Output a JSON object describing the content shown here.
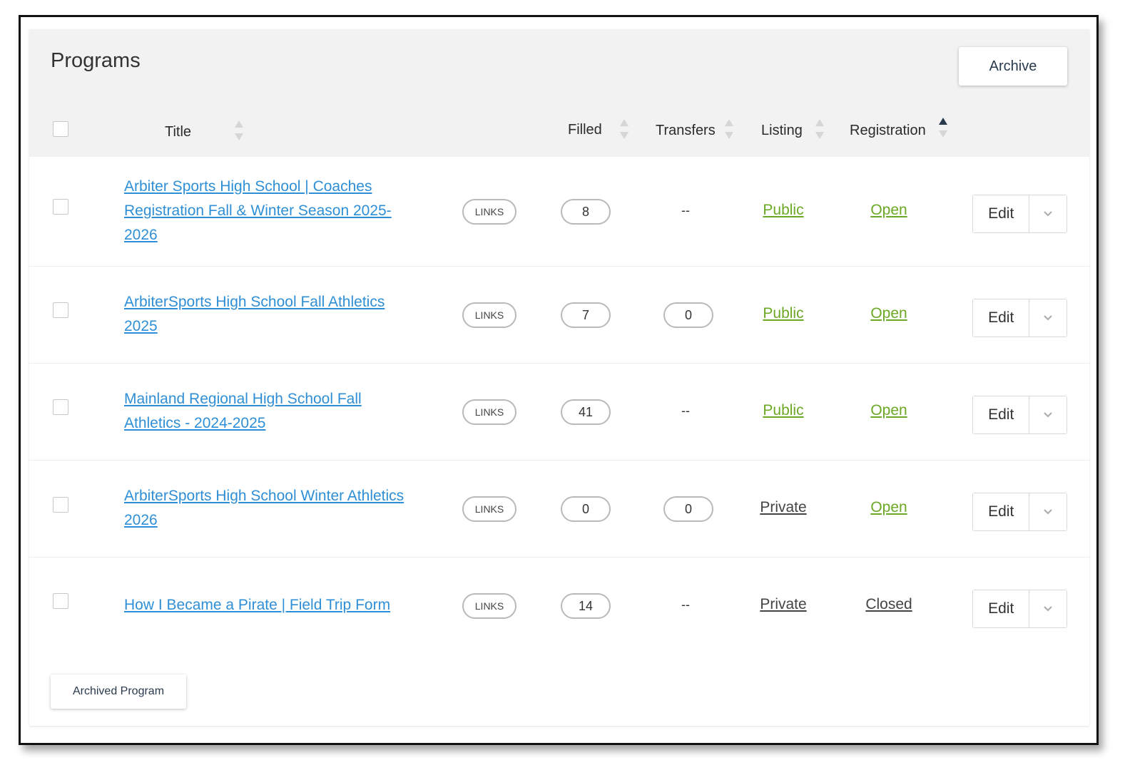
{
  "page": {
    "title": "Programs"
  },
  "toolbar": {
    "archive_label": "Archive"
  },
  "table": {
    "headers": {
      "title": "Title",
      "filled": "Filled",
      "transfers": "Transfers",
      "listing": "Listing",
      "registration": "Registration"
    },
    "sort": {
      "active_column": "registration",
      "direction": "ascending"
    },
    "rows": [
      {
        "title_lines": [
          "Arbiter Sports High School | Coaches",
          "Registration Fall & Winter Season 2025-",
          "2026"
        ],
        "links": "LINKS",
        "filled": "8",
        "transfers": "--",
        "listing": "Public",
        "registration": "Open",
        "edit": "Edit"
      },
      {
        "title_lines": [
          "ArbiterSports High School Fall Athletics",
          "2025"
        ],
        "links": "LINKS",
        "filled": "7",
        "transfers": "0",
        "listing": "Public",
        "registration": "Open",
        "edit": "Edit"
      },
      {
        "title_lines": [
          "Mainland Regional High School Fall",
          "Athletics - 2024-2025"
        ],
        "links": "LINKS",
        "filled": "41",
        "transfers": "--",
        "listing": "Public",
        "registration": "Open",
        "edit": "Edit"
      },
      {
        "title_lines": [
          "ArbiterSports High School Winter Athletics",
          "2026"
        ],
        "links": "LINKS",
        "filled": "0",
        "transfers": "0",
        "listing": "Private",
        "registration": "Open",
        "edit": "Edit"
      },
      {
        "title_lines": [
          "How I Became a Pirate | Field Trip Form"
        ],
        "links": "LINKS",
        "filled": "14",
        "transfers": "--",
        "listing": "Private",
        "registration": "Closed",
        "edit": "Edit"
      }
    ]
  },
  "footer": {
    "archived_label": "Archived Program"
  },
  "colors": {
    "link": "#2f8fd6",
    "open_public": "#6ba824",
    "header_bg": "#f2f2f2"
  }
}
